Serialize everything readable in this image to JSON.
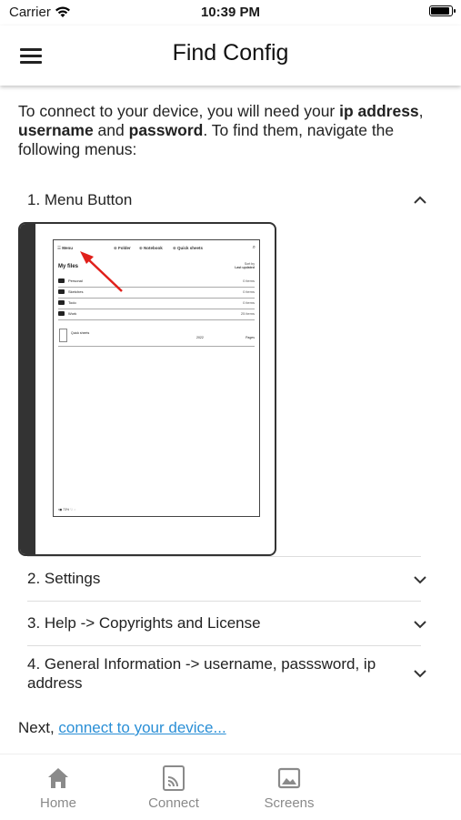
{
  "status_bar": {
    "carrier": "Carrier",
    "time": "10:39 PM",
    "battery_level": 0.9
  },
  "app_bar": {
    "title": "Find Config",
    "menu_icon": "hamburger-icon"
  },
  "intro": {
    "text_1": "To connect to your device, you will need your ",
    "bold_1": "ip address",
    "text_2": ", ",
    "bold_2": "username",
    "text_3": " and ",
    "bold_3": "password",
    "text_4": ". To find them, navigate the following menus:"
  },
  "panels": [
    {
      "label": "1. Menu Button",
      "expanded": true
    },
    {
      "label": "2. Settings",
      "expanded": false
    },
    {
      "label": "3. Help -> Copyrights and License",
      "expanded": false
    },
    {
      "label": "4. General Information -> username, passsword, ip address",
      "expanded": false
    }
  ],
  "device_screen": {
    "menu": "Menu",
    "folder": "Folder",
    "notebook": "Notebook",
    "quick_sheets": "Quick sheets",
    "my_files": "My files",
    "sort_by": "Sort by",
    "last_updated": "Last updated",
    "folders": [
      {
        "name": "Personal",
        "count": "0 items"
      },
      {
        "name": "Sketches",
        "count": "0 items"
      },
      {
        "name": "Todo",
        "count": "0 items"
      },
      {
        "name": "Work",
        "count": "25 items"
      }
    ],
    "quick_sheet_name": "Quick sheets",
    "quick_sheet_date": "2022",
    "quick_sheet_pages": "Pages",
    "battery": "73%",
    "annotation_color": "#e0201b"
  },
  "footer": {
    "next_prefix": "Next, ",
    "next_link": "connect to your device..."
  },
  "tabs": [
    {
      "label": "Home",
      "icon": "home-icon"
    },
    {
      "label": "Connect",
      "icon": "cast-icon"
    },
    {
      "label": "Screens",
      "icon": "image-icon"
    }
  ],
  "colors": {
    "link": "#2a8fd6",
    "tab_inactive": "#8a8a8a"
  }
}
